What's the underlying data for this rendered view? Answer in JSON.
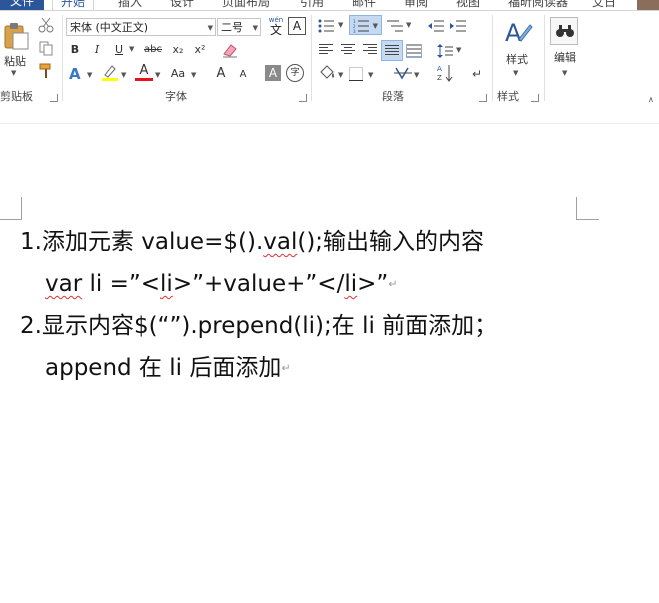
{
  "tabs": [
    "文件",
    "开始",
    "插入",
    "设计",
    "页面布局",
    "引用",
    "邮件",
    "审阅",
    "视图",
    "福昕阅读器",
    "艾日"
  ],
  "ribbon": {
    "clipboard": {
      "paste_label": "粘贴",
      "group_label": "剪贴板"
    },
    "font": {
      "font_name": "宋体 (中文正文)",
      "font_size": "二号",
      "wen_label": "wén",
      "wen_char": "文",
      "big_a": "A",
      "bold": "B",
      "italic": "I",
      "underline": "U",
      "strike": "abc",
      "subscript": "x₂",
      "superscript": "x²",
      "aa_label": "Aa",
      "grow": "A",
      "shrink": "A",
      "char_border": "A",
      "phonetic": "字",
      "group_label": "字体"
    },
    "paragraph": {
      "group_label": "段落"
    },
    "styles": {
      "label": "样式",
      "group_label": "样式"
    },
    "editing": {
      "label": "编辑"
    }
  },
  "document": {
    "paragraphs": [
      {
        "number": "1.",
        "line1_prefix": "添加元素  value=$().",
        "line1_val": "val",
        "line1_suffix": "();输出输入的内容",
        "line2_var": "var",
        "line2_mid": " li =”<",
        "line2_li1": "li",
        "line2_mid2": ">”+value+”</",
        "line2_li2": "li",
        "line2_end": ">”"
      },
      {
        "number": "2.",
        "line1": "显示内容$(“”).prepend(li);在 li 前面添加；",
        "line2": "append 在 li 后面添加"
      }
    ],
    "para_mark": "↵"
  }
}
